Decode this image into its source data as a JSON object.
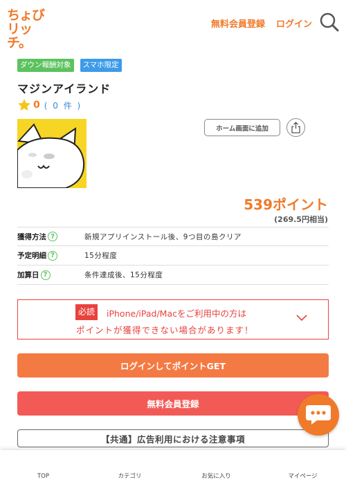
{
  "header": {
    "logo_line1": "ちょび",
    "logo_line2": "リッチ。",
    "register_label": "無料会員登録",
    "login_label": "ログイン",
    "search_icon": "search-icon"
  },
  "badges": [
    "ダウン報酬対象",
    "スマホ限定"
  ],
  "app": {
    "title": "マジンアイランド",
    "rating_value": "0",
    "rating_count": "( 0 件 )",
    "icon": "white-cat-app-icon",
    "home_screen_label": "ホーム画面に追加",
    "share_icon": "share-icon"
  },
  "points": {
    "amount": "539ポイント",
    "yen": "(269.5円相当)"
  },
  "info": [
    {
      "key": "獲得方法",
      "value": "新規アプリインストール後、9つ目の島クリア"
    },
    {
      "key": "予定明細",
      "value": "15分程度"
    },
    {
      "key": "加算日",
      "value": "条件達成後、15分程度"
    }
  ],
  "notice": {
    "tag": "必読",
    "line1": "iPhone/iPad/Macをご利用中の方は",
    "line2": "ポイントが獲得できない場合があります！"
  },
  "buttons": {
    "login_points": "ログインしてポイントGET",
    "register": "無料会員登録",
    "ad_notice": "【共通】広告利用における注意事項"
  },
  "bottom_nav": [
    "TOP",
    "カテゴリ",
    "お気に入り",
    "マイページ"
  ],
  "colors": {
    "brand_orange": "#f07a2a",
    "alert_red": "#e8423d",
    "badge_green": "#5bc25e",
    "badge_blue": "#3d9be9"
  }
}
